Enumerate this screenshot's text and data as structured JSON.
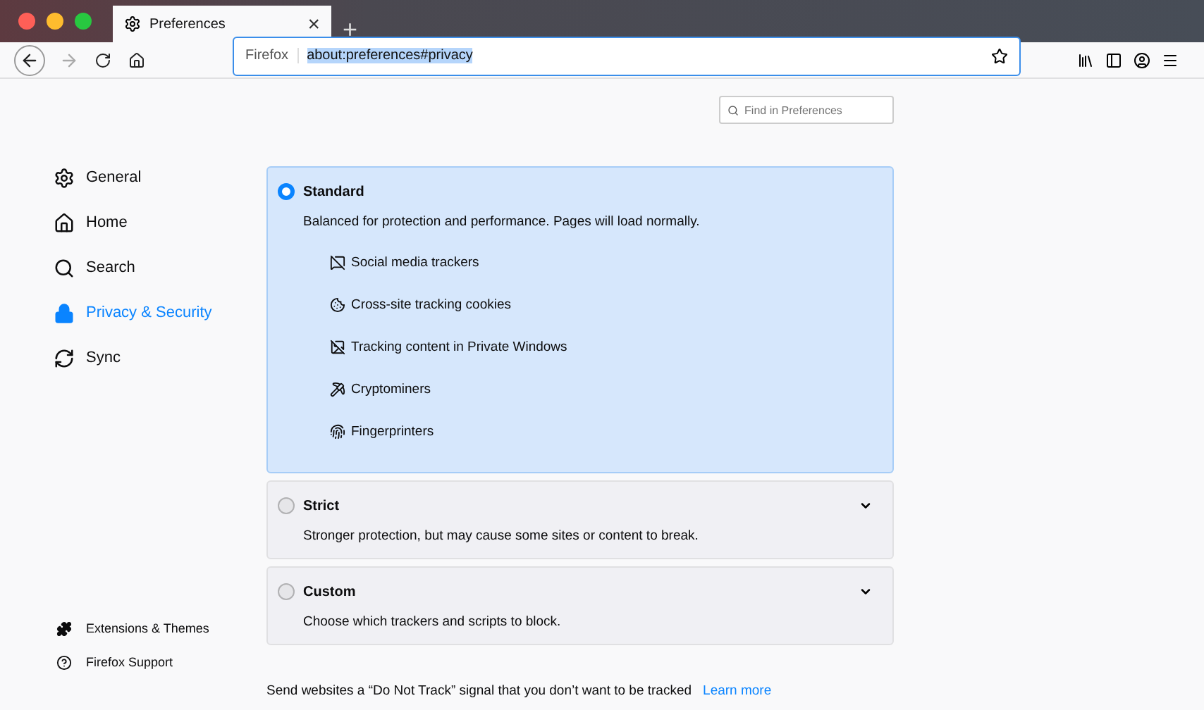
{
  "tab": {
    "title": "Preferences",
    "close": "×",
    "new_tab": "+"
  },
  "urlbar": {
    "identity": "Firefox",
    "url": "about:preferences#privacy"
  },
  "search": {
    "placeholder": "Find in Preferences"
  },
  "sidebar": {
    "items": [
      {
        "label": "General",
        "kind": "gear",
        "selected": false
      },
      {
        "label": "Home",
        "kind": "home",
        "selected": false
      },
      {
        "label": "Search",
        "kind": "search",
        "selected": false
      },
      {
        "label": "Privacy & Security",
        "kind": "lock",
        "selected": true
      },
      {
        "label": "Sync",
        "kind": "sync",
        "selected": false
      }
    ],
    "footer": [
      {
        "label": "Extensions & Themes",
        "kind": "puzzle"
      },
      {
        "label": "Firefox Support",
        "kind": "help"
      }
    ]
  },
  "options": [
    {
      "title": "Standard",
      "description": "Balanced for protection and performance. Pages will load normally.",
      "selected": true,
      "expanded": true,
      "trackers": [
        {
          "label": "Social media trackers",
          "kind": "social"
        },
        {
          "label": "Cross-site tracking cookies",
          "kind": "cookie"
        },
        {
          "label": "Tracking content in Private Windows",
          "kind": "content"
        },
        {
          "label": "Cryptominers",
          "kind": "crypto"
        },
        {
          "label": "Fingerprinters",
          "kind": "finger"
        }
      ]
    },
    {
      "title": "Strict",
      "description": "Stronger protection, but may cause some sites or content to break.",
      "selected": false,
      "expanded": false
    },
    {
      "title": "Custom",
      "description": "Choose which trackers and scripts to block.",
      "selected": false,
      "expanded": false
    }
  ],
  "dnt": {
    "text": "Send websites a “Do Not Track” signal that you don’t want to be tracked",
    "link": "Learn more"
  }
}
